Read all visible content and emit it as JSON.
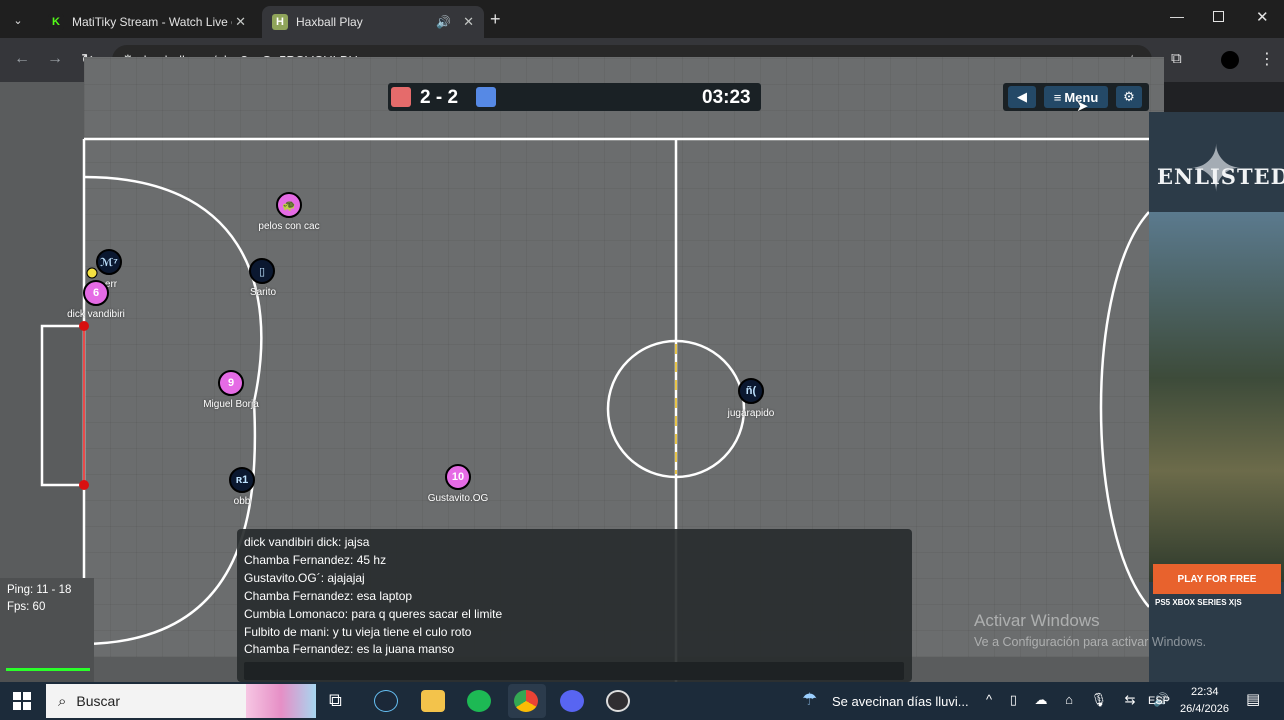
{
  "browser": {
    "tabs": [
      {
        "title": "MatiTiky Stream - Watch Live o",
        "favicon": "K"
      },
      {
        "title": "Haxball Play",
        "favicon": "H"
      }
    ],
    "url": "haxball.com/play?c=Ou5PQVCULBU"
  },
  "game": {
    "score": "2 - 2",
    "time": "03:23",
    "menu_label": "Menu",
    "colors": {
      "red": "#e56be5",
      "blue": "#0b1830",
      "pitch": "#6b6d6e"
    },
    "players": [
      {
        "label": "🐢",
        "name": "pelos con cac",
        "team": "red"
      },
      {
        "label": "ℳ⁷",
        "name": "err",
        "team": "blue"
      },
      {
        "label": "6",
        "name": "dick vandibiri",
        "team": "red"
      },
      {
        "label": "▯",
        "name": "Sarito",
        "team": "blue"
      },
      {
        "label": "9",
        "name": "Miguel Borja",
        "team": "red"
      },
      {
        "label": "ʀ1",
        "name": "obb",
        "team": "blue"
      },
      {
        "label": "10",
        "name": "Gustavito.OG",
        "team": "red"
      },
      {
        "label": "ñ(",
        "name": "jugarapido",
        "team": "blue"
      }
    ],
    "chat": [
      "dick vandibiri dick: jajsa",
      "Chamba Fernandez: 45 hz",
      "Gustavito.OG´: ajajajaj",
      "Chamba Fernandez: esa laptop",
      "Cumbia Lomonaco: para q queres sacar el limite",
      "Fulbito de mani: y tu vieja tiene el culo roto",
      "Chamba Fernandez: es la juana manso"
    ],
    "ping": "Ping: 11 - 18",
    "fps": "Fps: 60"
  },
  "ad": {
    "title": "ENLISTED",
    "cta": "PLAY FOR FREE",
    "platforms": "PS5  XBOX SERIES X|S"
  },
  "watermark": {
    "line1": "Activar Windows",
    "line2": "Ve a Configuración para activar Windows."
  },
  "taskbar": {
    "search_placeholder": "Buscar",
    "weather": "Se avecinan días lluvi...",
    "lang": "ESP",
    "time": "22:34",
    "date": "26/4/2026"
  }
}
